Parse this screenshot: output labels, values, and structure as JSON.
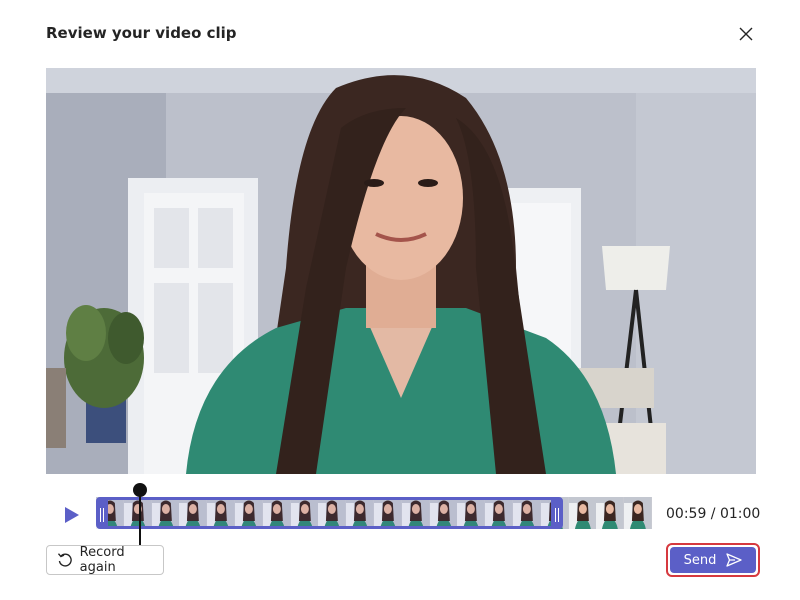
{
  "dialog": {
    "title": "Review your video clip",
    "close_icon": "close-icon"
  },
  "video": {
    "description_icon": "video-frame"
  },
  "player": {
    "play_icon": "play-icon",
    "time": "00:59 / 01:00",
    "progress_fraction": 0.08,
    "trim_selection_fraction": 0.84,
    "thumbnail_count": 20
  },
  "actions": {
    "record_again_label": "Record again",
    "record_again_icon": "undo-icon",
    "send_label": "Send",
    "send_icon": "send-icon"
  },
  "colors": {
    "accent": "#5b5fc7",
    "focus_ring": "#d6393f"
  }
}
